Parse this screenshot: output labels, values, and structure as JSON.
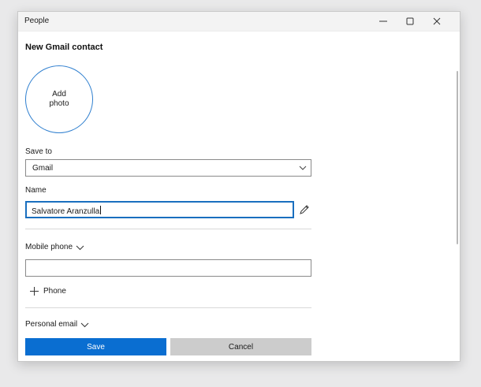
{
  "window": {
    "title": "People"
  },
  "form": {
    "heading": "New Gmail contact",
    "photo_label": "Add\nphoto",
    "save_to": {
      "label": "Save to",
      "value": "Gmail"
    },
    "name": {
      "label": "Name",
      "value": "Salvatore Aranzulla"
    },
    "mobile_phone": {
      "label": "Mobile phone",
      "value": ""
    },
    "add_phone_label": "Phone",
    "personal_email_label": "Personal email"
  },
  "buttons": {
    "save": "Save",
    "cancel": "Cancel"
  },
  "colors": {
    "accent": "#0a6ed1",
    "photo_ring": "#2f7fcf",
    "cancel_bg": "#cccccc"
  }
}
